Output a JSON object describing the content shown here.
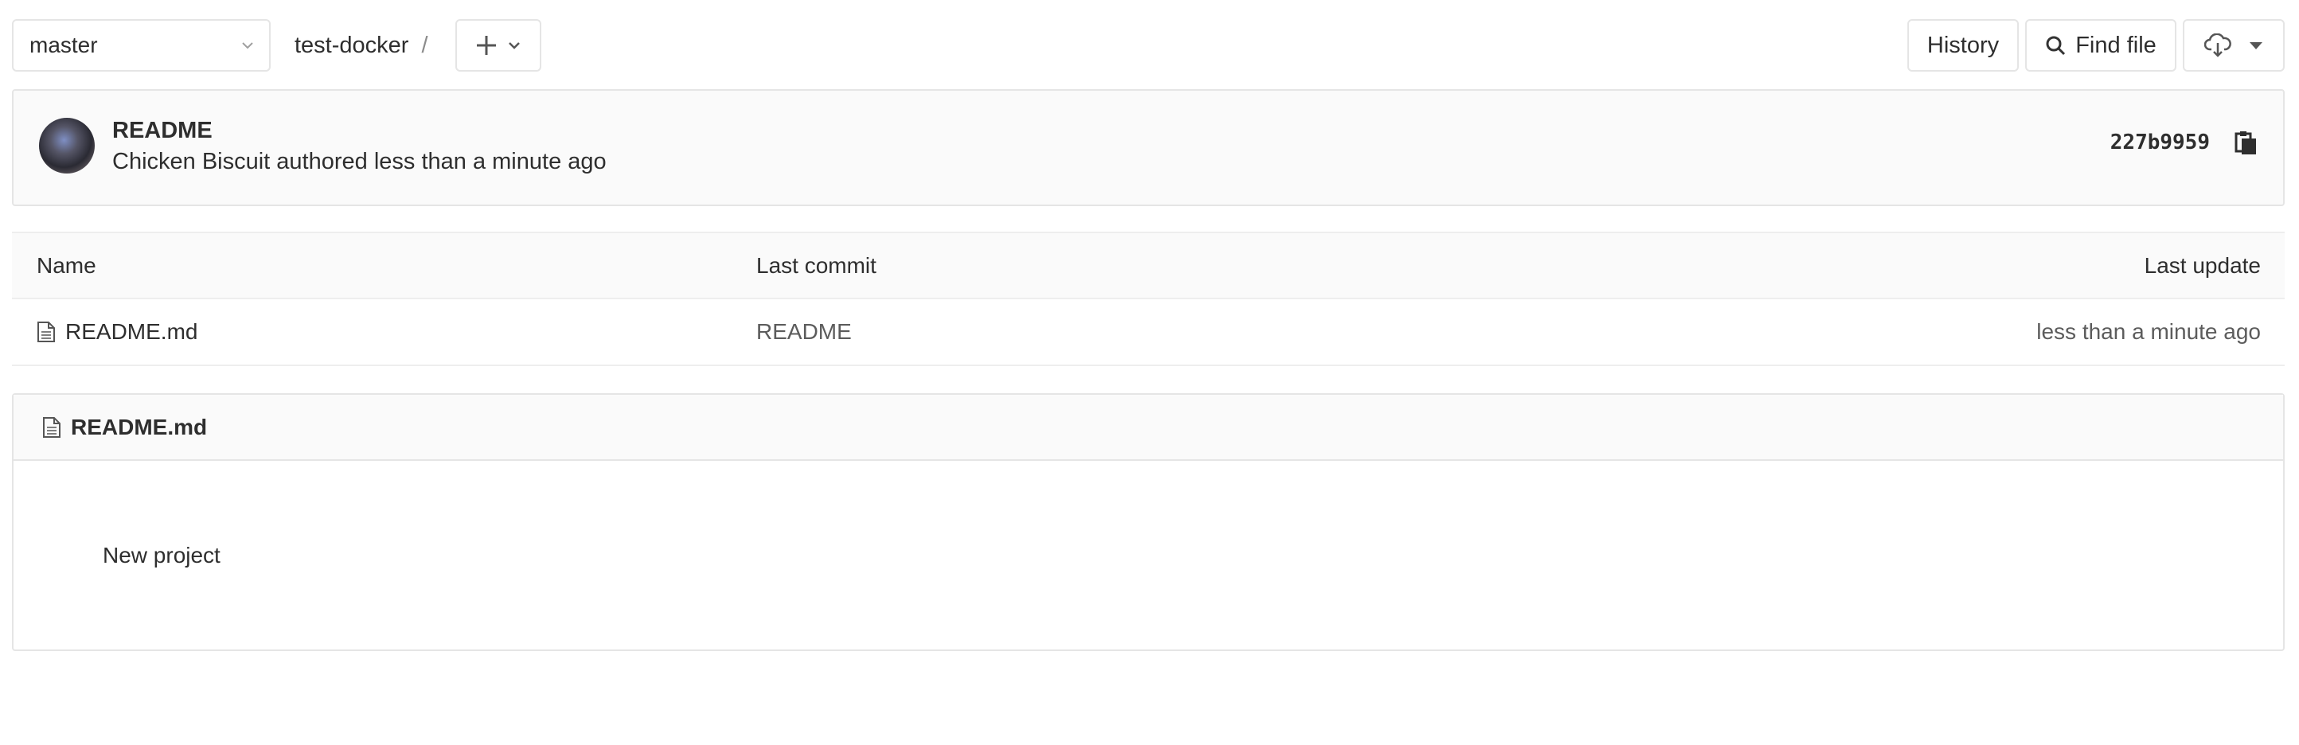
{
  "nav": {
    "branch": "master",
    "project": "test-docker",
    "separator": "/",
    "history_label": "History",
    "find_file_label": "Find file"
  },
  "commit": {
    "title": "README",
    "meta": "Chicken Biscuit authored less than a minute ago",
    "sha": "227b9959"
  },
  "table": {
    "headers": {
      "name": "Name",
      "last_commit": "Last commit",
      "last_update": "Last update"
    },
    "rows": [
      {
        "name": "README.md",
        "last_commit": "README",
        "last_update": "less than a minute ago"
      }
    ]
  },
  "readme": {
    "filename": "README.md",
    "content": "New project"
  },
  "icons": {
    "branch_chevron": "chevron-down-icon",
    "add": "plus-icon",
    "search": "search-icon",
    "download": "cloud-download-icon",
    "copy": "copy-icon",
    "file": "file-icon"
  }
}
